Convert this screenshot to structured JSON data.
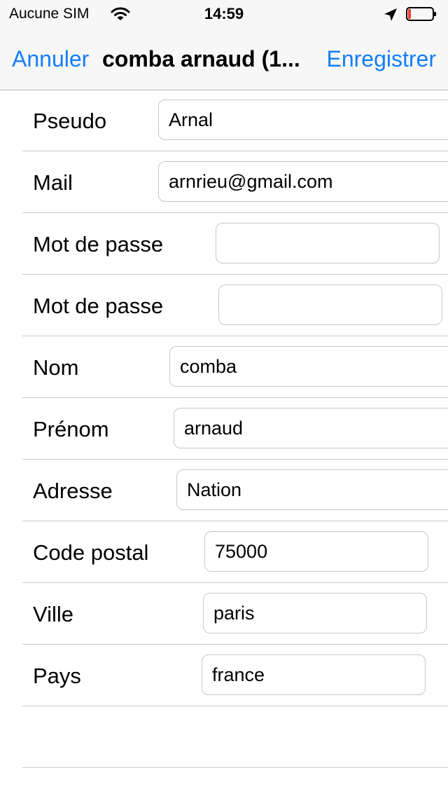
{
  "status_bar": {
    "carrier": "Aucune SIM",
    "time": "14:59",
    "icons": [
      "wifi-icon",
      "location-arrow-icon",
      "battery-low-icon"
    ],
    "battery_color": "#ff3b30"
  },
  "nav": {
    "left_label": "Annuler",
    "title": "comba arnaud (1...",
    "right_label": "Enregistrer",
    "accent_color": "#157efb"
  },
  "form": {
    "fields": [
      {
        "label": "Pseudo",
        "value": "Arnal"
      },
      {
        "label": "Mail",
        "value": "arnrieu@gmail.com"
      },
      {
        "label": "Mot de passe",
        "value": ""
      },
      {
        "label": "Mot de passe",
        "value": ""
      },
      {
        "label": "Nom",
        "value": "comba"
      },
      {
        "label": "Prénom",
        "value": "arnaud"
      },
      {
        "label": "Adresse",
        "value": "Nation"
      },
      {
        "label": "Code postal",
        "value": "75000"
      },
      {
        "label": "Ville",
        "value": "paris"
      },
      {
        "label": "Pays",
        "value": "france"
      }
    ]
  }
}
